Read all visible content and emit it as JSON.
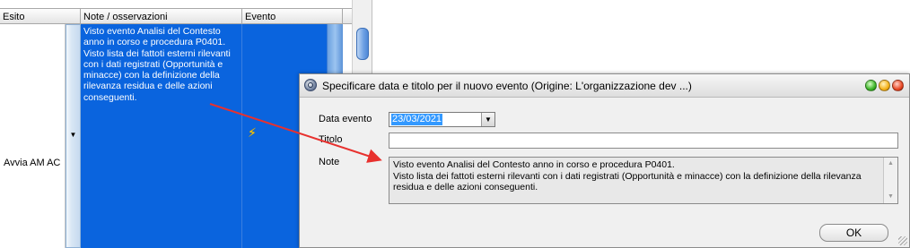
{
  "grid": {
    "headers": {
      "esito": "Esito",
      "note": "Note / osservazioni",
      "evento": "Evento"
    },
    "row": {
      "esito": "Avvia AM AC",
      "note": "Visto evento  Analisi del Contesto\nanno in corso e procedura P0401.\nVisto lista dei fattoti esterni rilevanti\ncon i dati registrati (Opportunità e\nminacce) con la definizione della\nrilevanza residua e delle azioni\nconseguenti.",
      "evento_icon": "lightning-icon"
    },
    "selection_color": "#0a64de"
  },
  "dialog": {
    "title": "Specificare data e titolo per il nuovo evento (Origine: L'organizzazione dev ...)",
    "fields": {
      "data_evento_label": "Data evento",
      "data_evento_value": "23/03/2021",
      "titolo_label": "Titolo",
      "titolo_value": "",
      "note_label": "Note",
      "note_value": "Visto evento Analisi del Contesto anno in corso e procedura P0401.\nVisto lista dei fattoti esterni rilevanti con i dati registrati (Opportunità e minacce) con la definizione della rilevanza\nresidua e delle azioni conseguenti."
    },
    "ok_label": "OK",
    "window_buttons": [
      "green",
      "yellow",
      "red"
    ]
  },
  "annotation_color": "#e8312e"
}
